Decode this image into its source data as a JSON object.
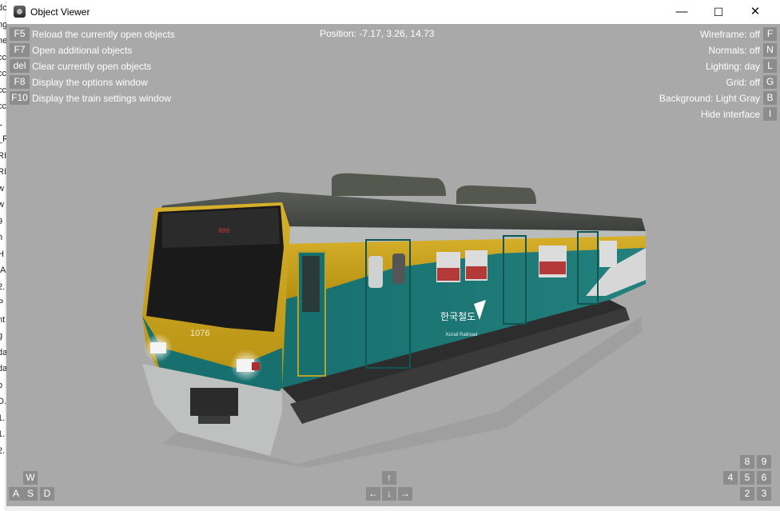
{
  "window": {
    "title": "Object Viewer",
    "min_glyph": "—",
    "max_glyph": "☐",
    "close_glyph": "✕"
  },
  "left_fragments": [
    "dc",
    "ng",
    "ne",
    "cc",
    "cc",
    "cc",
    "cc",
    "L",
    "_R",
    "RI",
    "RI",
    "w",
    "w",
    "9",
    "h",
    "H",
    ".A",
    "2.",
    "P",
    "nt",
    "g",
    "da",
    "da",
    "b",
    "D.",
    "1.",
    "1.",
    "2."
  ],
  "hud_left": [
    {
      "key": "F5",
      "text": "Reload the currently open objects"
    },
    {
      "key": "F7",
      "text": "Open additional objects"
    },
    {
      "key": "del",
      "text": "Clear currently open objects"
    },
    {
      "key": "F8",
      "text": "Display the options window"
    },
    {
      "key": "F10",
      "text": "Display the train settings window"
    }
  ],
  "position": "Position: -7.17, 3.26, 14.73",
  "hud_right": [
    {
      "text": "Wireframe: off",
      "key": "F"
    },
    {
      "text": "Normals: off",
      "key": "N"
    },
    {
      "text": "Lighting: day",
      "key": "L"
    },
    {
      "text": "Grid: off",
      "key": "G"
    },
    {
      "text": "Background: Light Gray",
      "key": "B"
    },
    {
      "text": "Hide interface",
      "key": "I"
    }
  ],
  "wasd": {
    "w": "W",
    "a": "A",
    "s": "S",
    "d": "D"
  },
  "arrows": {
    "up": "↑",
    "left": "←",
    "down": "↓",
    "right": "→"
  },
  "numpad": {
    "n8": "8",
    "n9": "9",
    "n4": "4",
    "n5": "5",
    "n6": "6",
    "n2": "2",
    "n3": "3"
  },
  "train": {
    "number": "1076",
    "logo": "한국철도",
    "dest": "888"
  },
  "colors": {
    "viewport_bg": "#a9a9a9",
    "key_bg": "#8c8c8c",
    "train_teal": "#1f7a78",
    "train_yellow": "#c9a41a"
  }
}
